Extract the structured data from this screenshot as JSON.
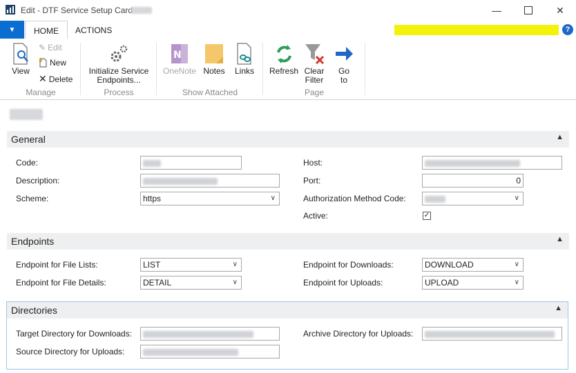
{
  "window": {
    "title": "Edit - DTF Service Setup Card -",
    "minimize_icon": "minimize-icon",
    "maximize_icon": "maximize-icon",
    "close_icon": "close-icon"
  },
  "ribbon": {
    "tabs": [
      "HOME",
      "ACTIONS"
    ],
    "active_tab": "HOME",
    "help_label": "?",
    "groups": {
      "manage": {
        "label": "Manage",
        "view": "View",
        "edit": "Edit",
        "new": "New",
        "delete": "Delete"
      },
      "process": {
        "label": "Process",
        "initialize_line1": "Initialize Service",
        "initialize_line2": "Endpoints..."
      },
      "show_attached": {
        "label": "Show Attached",
        "onenote": "OneNote",
        "notes": "Notes",
        "links": "Links"
      },
      "page": {
        "label": "Page",
        "refresh": "Refresh",
        "clear_line1": "Clear",
        "clear_line2": "Filter",
        "goto_line1": "Go",
        "goto_line2": "to"
      }
    }
  },
  "sections": {
    "general": {
      "title": "General",
      "code_label": "Code:",
      "description_label": "Description:",
      "scheme_label": "Scheme:",
      "scheme_value": "https",
      "host_label": "Host:",
      "port_label": "Port:",
      "port_value": "0",
      "auth_label": "Authorization Method Code:",
      "active_label": "Active:",
      "active_checked": true
    },
    "endpoints": {
      "title": "Endpoints",
      "file_lists_label": "Endpoint for File Lists:",
      "file_lists_value": "LIST",
      "file_details_label": "Endpoint for File Details:",
      "file_details_value": "DETAIL",
      "downloads_label": "Endpoint for Downloads:",
      "downloads_value": "DOWNLOAD",
      "uploads_label": "Endpoint for Uploads:",
      "uploads_value": "UPLOAD"
    },
    "directories": {
      "title": "Directories",
      "target_downloads_label": "Target Directory for Downloads:",
      "source_uploads_label": "Source Directory for Uploads:",
      "archive_uploads_label": "Archive Directory for Uploads:"
    }
  },
  "colors": {
    "app_menu_blue": "#0a6ed1",
    "company_highlight": "#f2f20a",
    "section_header": "#eeeff0",
    "focus_border": "#9ec3ea"
  }
}
